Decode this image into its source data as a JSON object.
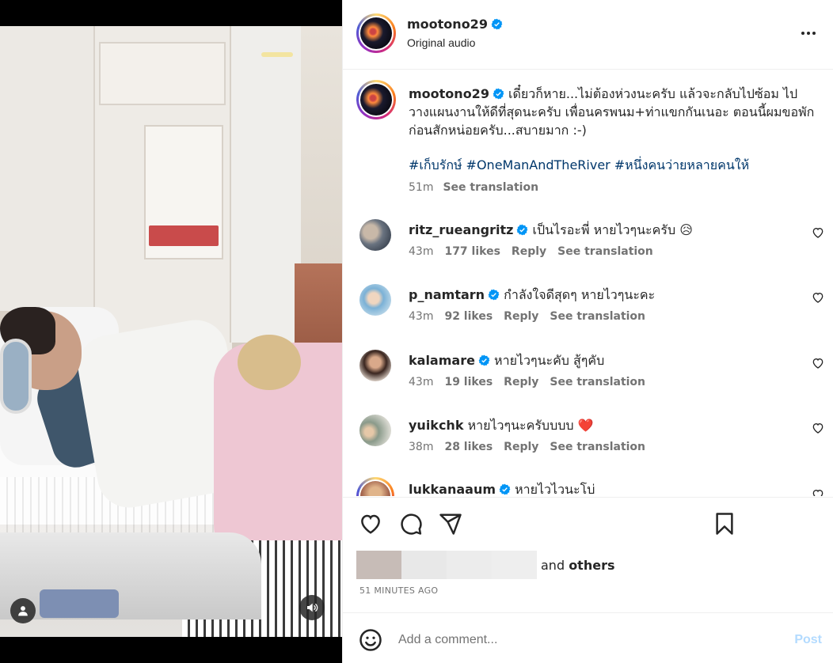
{
  "header": {
    "username": "mootono29",
    "subtitle": "Original audio"
  },
  "caption": {
    "username": "mootono29",
    "text": "เดี๋ยวก็หาย...ไม่ต้องห่วงนะครับ แล้วจะกลับไปซ้อม ไปวางแผนงานให้ดีที่สุดนะครับ เพื่อนครพนม+ท่าแขกกันเนอะ ตอนนี้ผมขอพักก่อนสักหน่อยครับ...สบายมาก :-)",
    "hashtags": [
      "#เก็บรักษ์",
      "#OneManAndTheRiver",
      "#หนึ่งคนว่ายหลายคนให้"
    ],
    "time": "51m",
    "see_translation": "See translation"
  },
  "comments": [
    {
      "username": "ritz_rueangritz",
      "verified": true,
      "text": "เป็นไรอะพี่ หายไวๆนะครับ 😥",
      "time": "43m",
      "likes": "177 likes",
      "reply": "Reply",
      "see_translation": "See translation"
    },
    {
      "username": "p_namtarn",
      "verified": true,
      "text": "กำลังใจดีสุดๆ หายไวๆนะคะ",
      "time": "43m",
      "likes": "92 likes",
      "reply": "Reply",
      "see_translation": "See translation"
    },
    {
      "username": "kalamare",
      "verified": true,
      "text": "หายไวๆนะคับ สู้ๆคับ",
      "time": "43m",
      "likes": "19 likes",
      "reply": "Reply",
      "see_translation": "See translation"
    },
    {
      "username": "yuikchk",
      "verified": false,
      "text": "หายไวๆนะครับบบบ ❤️",
      "time": "38m",
      "likes": "28 likes",
      "reply": "Reply",
      "see_translation": "See translation"
    },
    {
      "username": "lukkanaaum",
      "verified": true,
      "text": "หายไวไวนะโบ่",
      "time": "",
      "likes": "",
      "reply": "",
      "see_translation": ""
    }
  ],
  "likes": {
    "prefix": "and ",
    "others": "others"
  },
  "time_ago": "51 MINUTES AGO",
  "add_comment": {
    "placeholder": "Add a comment...",
    "post_label": "Post"
  },
  "colors": {
    "verified": "#0095f6",
    "link": "#00376b",
    "post_disabled": "#b3dbff",
    "secondary_text": "#737373"
  },
  "icons": [
    "user-icon",
    "speaker-icon",
    "more-icon",
    "verified-icon",
    "heart-icon",
    "comment-icon",
    "share-icon",
    "bookmark-icon",
    "emoji-icon"
  ]
}
